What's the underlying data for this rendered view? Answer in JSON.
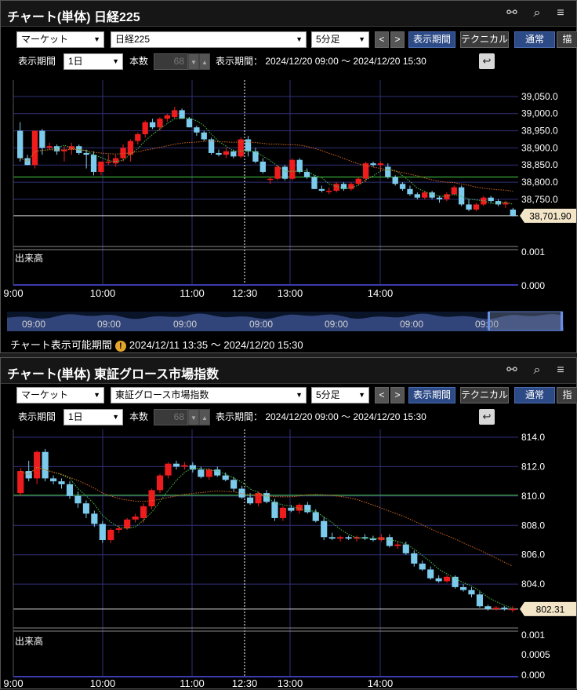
{
  "icons": {
    "link": "link-icon",
    "search": "search-icon",
    "menu": "menu-icon",
    "warning": "warning-icon",
    "reset": "reset-icon"
  },
  "colors": {
    "up": "#ee1c1c",
    "down": "#7ccbec",
    "ma_short": "#4cc24c",
    "ma_long": "#d2691e",
    "hline": "#44cc44",
    "price_tag": "#f3e6c8"
  },
  "panels": [
    {
      "title": "チャート(単体) 日経225",
      "market_select": "マーケット",
      "symbol_select": "日経225",
      "interval_select": "5分足",
      "prev": "<",
      "next": ">",
      "period_button": "表示期間",
      "technical_button": "テクニカル",
      "normal_button": "通常",
      "cut_button": "描",
      "period_label": "表示期間",
      "period_select": "1日",
      "count_label": "本数",
      "count_value": "68",
      "range_text": "表示期間： 2024/12/20 09:00 ～ 2024/12/20 15:30",
      "volume_label": "出来高",
      "price_label": "38,701.90",
      "navigator_labels": [
        "09:00",
        "09:00",
        "09:00",
        "09:00",
        "09:00",
        "09:00",
        "09:00"
      ],
      "available_label": "チャート表示可能期間",
      "available_range": "2024/12/11 13:35 ～ 2024/12/20 15:30"
    },
    {
      "title": "チャート(単体) 東証グロース市場指数",
      "market_select": "マーケット",
      "symbol_select": "東証グロース市場指数",
      "interval_select": "5分足",
      "prev": "<",
      "next": ">",
      "period_button": "表示期間",
      "technical_button": "テクニカル",
      "normal_button": "通常",
      "cut_button": "指",
      "period_label": "表示期間",
      "period_select": "1日",
      "count_label": "本数",
      "count_value": "68",
      "range_text": "表示期間： 2024/12/20 09:00 ～ 2024/12/20 15:30",
      "volume_label": "出来高",
      "price_label": "802.31"
    }
  ],
  "chart_data": [
    {
      "type": "candlestick",
      "title": "日経225",
      "x_ticks": [
        "9:00",
        "10:00",
        "11:00",
        "12:30",
        "13:00",
        "14:00"
      ],
      "y_ticks": [
        "39,050.0",
        "39,000.0",
        "38,950.0",
        "38,900.0",
        "38,850.0",
        "38,800.0",
        "38,750.0"
      ],
      "ylim": [
        38705,
        39070
      ],
      "hline": 38815,
      "last_price": 38701.9,
      "volume_ticks": [
        "0.001",
        "0.000"
      ],
      "candles": [
        [
          38950,
          38975,
          38860,
          38870
        ],
        [
          38870,
          38880,
          38850,
          38850
        ],
        [
          38850,
          38950,
          38840,
          38950
        ],
        [
          38950,
          38955,
          38880,
          38900
        ],
        [
          38900,
          38915,
          38895,
          38905
        ],
        [
          38905,
          38910,
          38880,
          38890
        ],
        [
          38890,
          38905,
          38860,
          38895
        ],
        [
          38895,
          38915,
          38880,
          38905
        ],
        [
          38905,
          38910,
          38880,
          38885
        ],
        [
          38885,
          38895,
          38840,
          38880
        ],
        [
          38880,
          38890,
          38820,
          38830
        ],
        [
          38830,
          38860,
          38820,
          38860
        ],
        [
          38860,
          38880,
          38850,
          38860
        ],
        [
          38855,
          38880,
          38845,
          38870
        ],
        [
          38870,
          38910,
          38860,
          38900
        ],
        [
          38880,
          38925,
          38860,
          38920
        ],
        [
          38920,
          38945,
          38910,
          38940
        ],
        [
          38940,
          38980,
          38930,
          38975
        ],
        [
          38975,
          38985,
          38955,
          38960
        ],
        [
          38960,
          38990,
          38950,
          38985
        ],
        [
          38985,
          39000,
          38975,
          38995
        ],
        [
          38990,
          39020,
          38985,
          39010
        ],
        [
          39010,
          39015,
          38985,
          38985
        ],
        [
          38985,
          38990,
          38960,
          38960
        ],
        [
          38960,
          38965,
          38935,
          38945
        ],
        [
          38945,
          38950,
          38920,
          38925
        ],
        [
          38925,
          38930,
          38880,
          38885
        ],
        [
          38885,
          38895,
          38875,
          38880
        ],
        [
          38880,
          38900,
          38870,
          38890
        ],
        [
          38890,
          38895,
          38870,
          38875
        ],
        [
          38875,
          38930,
          38870,
          38925
        ],
        [
          38925,
          38935,
          38875,
          38890
        ],
        [
          38890,
          38900,
          38855,
          38860
        ],
        [
          38860,
          38870,
          38825,
          38830
        ],
        [
          38810,
          38815,
          38795,
          38810
        ],
        [
          38810,
          38850,
          38805,
          38845
        ],
        [
          38845,
          38850,
          38805,
          38810
        ],
        [
          38810,
          38870,
          38805,
          38865
        ],
        [
          38865,
          38870,
          38825,
          38830
        ],
        [
          38830,
          38840,
          38810,
          38815
        ],
        [
          38815,
          38820,
          38780,
          38780
        ],
        [
          38780,
          38790,
          38770,
          38775
        ],
        [
          38775,
          38785,
          38765,
          38775
        ],
        [
          38775,
          38800,
          38770,
          38795
        ],
        [
          38795,
          38800,
          38775,
          38780
        ],
        [
          38780,
          38800,
          38775,
          38795
        ],
        [
          38795,
          38815,
          38790,
          38810
        ],
        [
          38810,
          38860,
          38800,
          38855
        ],
        [
          38855,
          38860,
          38845,
          38850
        ],
        [
          38850,
          38860,
          38830,
          38855
        ],
        [
          38845,
          38855,
          38810,
          38815
        ],
        [
          38815,
          38820,
          38790,
          38795
        ],
        [
          38795,
          38800,
          38775,
          38780
        ],
        [
          38780,
          38790,
          38760,
          38765
        ],
        [
          38765,
          38770,
          38750,
          38755
        ],
        [
          38755,
          38775,
          38750,
          38770
        ],
        [
          38770,
          38775,
          38750,
          38755
        ],
        [
          38755,
          38760,
          38740,
          38750
        ],
        [
          38750,
          38770,
          38745,
          38765
        ],
        [
          38765,
          38790,
          38760,
          38785
        ],
        [
          38785,
          38790,
          38730,
          38735
        ],
        [
          38735,
          38750,
          38715,
          38720
        ],
        [
          38720,
          38740,
          38715,
          38735
        ],
        [
          38735,
          38760,
          38730,
          38755
        ],
        [
          38755,
          38760,
          38740,
          38745
        ],
        [
          38745,
          38750,
          38730,
          38735
        ],
        [
          38735,
          38745,
          38725,
          38740
        ],
        [
          38720,
          38725,
          38700,
          38702
        ]
      ]
    },
    {
      "type": "candlestick",
      "title": "東証グロース市場指数",
      "x_ticks": [
        "9:00",
        "10:00",
        "11:00",
        "12:30",
        "13:00",
        "14:00"
      ],
      "y_ticks": [
        "814.0",
        "812.0",
        "810.0",
        "808.0",
        "806.0",
        "804.0"
      ],
      "ylim": [
        802.0,
        814.8
      ],
      "hline": 810.05,
      "last_price": 802.31,
      "volume_ticks": [
        "0.001",
        "0.0005",
        "0.000"
      ],
      "candles": [
        [
          810.2,
          811.9,
          810.0,
          811.7
        ],
        [
          811.7,
          812.4,
          811.0,
          811.2
        ],
        [
          811.2,
          813.1,
          810.8,
          813.0
        ],
        [
          813.0,
          813.2,
          811.0,
          811.2
        ],
        [
          811.2,
          811.4,
          810.8,
          811.0
        ],
        [
          811.0,
          811.2,
          810.5,
          810.8
        ],
        [
          810.8,
          811.0,
          809.8,
          810.0
        ],
        [
          810.0,
          810.3,
          809.2,
          809.5
        ],
        [
          809.5,
          809.7,
          808.5,
          808.8
        ],
        [
          808.8,
          809.0,
          807.9,
          808.1
        ],
        [
          808.1,
          808.3,
          806.8,
          807.0
        ],
        [
          807.0,
          807.8,
          806.8,
          807.7
        ],
        [
          807.7,
          808.0,
          807.5,
          807.8
        ],
        [
          807.8,
          808.5,
          807.7,
          808.4
        ],
        [
          808.4,
          808.8,
          808.2,
          808.6
        ],
        [
          808.5,
          809.5,
          808.2,
          809.3
        ],
        [
          809.3,
          810.5,
          809.1,
          810.4
        ],
        [
          810.4,
          811.5,
          810.2,
          811.4
        ],
        [
          811.4,
          812.3,
          811.2,
          812.2
        ],
        [
          812.2,
          812.4,
          811.8,
          812.0
        ],
        [
          812.0,
          812.3,
          811.8,
          812.1
        ],
        [
          812.1,
          812.3,
          811.6,
          811.8
        ],
        [
          811.8,
          812.0,
          811.2,
          811.3
        ],
        [
          811.3,
          811.9,
          811.1,
          811.8
        ],
        [
          811.8,
          812.0,
          811.3,
          811.4
        ],
        [
          811.4,
          811.6,
          811.0,
          811.1
        ],
        [
          811.1,
          811.3,
          810.3,
          810.5
        ],
        [
          810.5,
          810.7,
          809.8,
          809.9
        ],
        [
          809.9,
          810.2,
          809.4,
          809.5
        ],
        [
          809.5,
          810.3,
          809.3,
          810.2
        ],
        [
          810.2,
          810.4,
          809.5,
          809.6
        ],
        [
          809.6,
          809.8,
          808.3,
          808.5
        ],
        [
          808.5,
          809.3,
          808.3,
          809.2
        ],
        [
          809.2,
          809.4,
          808.9,
          809.0
        ],
        [
          809.0,
          809.5,
          808.8,
          809.4
        ],
        [
          809.4,
          809.6,
          808.8,
          808.9
        ],
        [
          808.9,
          809.1,
          808.2,
          808.3
        ],
        [
          808.3,
          808.6,
          807.0,
          807.2
        ],
        [
          807.2,
          807.5,
          807.0,
          807.1
        ],
        [
          807.1,
          807.3,
          806.9,
          807.2
        ],
        [
          807.2,
          807.3,
          807.0,
          807.1
        ],
        [
          807.1,
          807.3,
          806.9,
          807.2
        ],
        [
          807.2,
          807.4,
          807.0,
          807.1
        ],
        [
          807.1,
          807.3,
          806.9,
          807.0
        ],
        [
          807.0,
          807.4,
          806.9,
          807.2
        ],
        [
          807.2,
          807.4,
          806.5,
          806.6
        ],
        [
          806.6,
          806.9,
          806.4,
          806.7
        ],
        [
          806.7,
          806.9,
          806.0,
          806.1
        ],
        [
          806.1,
          806.3,
          805.2,
          805.4
        ],
        [
          805.4,
          805.6,
          804.9,
          805.0
        ],
        [
          805.0,
          805.2,
          804.3,
          804.4
        ],
        [
          804.4,
          804.6,
          804.1,
          804.2
        ],
        [
          804.2,
          804.6,
          804.1,
          804.5
        ],
        [
          804.5,
          804.6,
          803.7,
          803.8
        ],
        [
          803.8,
          804.0,
          803.5,
          803.6
        ],
        [
          803.6,
          803.8,
          803.1,
          803.3
        ],
        [
          803.3,
          803.5,
          802.4,
          802.5
        ],
        [
          802.5,
          802.6,
          802.2,
          802.3
        ],
        [
          802.3,
          802.5,
          802.2,
          802.4
        ],
        [
          802.4,
          802.5,
          802.2,
          802.3
        ],
        [
          802.3,
          802.5,
          802.1,
          802.31
        ]
      ]
    }
  ]
}
